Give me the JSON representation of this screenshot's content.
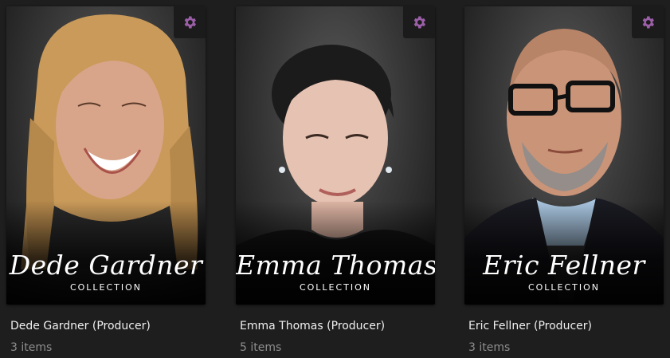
{
  "collections": [
    {
      "poster_script": "Dede Gardner",
      "poster_subtitle": "COLLECTION",
      "title": "Dede Gardner (Producer)",
      "count": "3 items",
      "hair_color": "#c99a5a",
      "skin_color": "#d9a58a"
    },
    {
      "poster_script": "Emma Thomas",
      "poster_subtitle": "COLLECTION",
      "title": "Emma Thomas (Producer)",
      "count": "5 items",
      "hair_color": "#1c1b1b",
      "skin_color": "#e6c2b2"
    },
    {
      "poster_script": "Eric Fellner",
      "poster_subtitle": "COLLECTION",
      "title": "Eric Fellner (Producer)",
      "count": "3 items",
      "hair_color": "#8c8c8c",
      "skin_color": "#c99478"
    }
  ],
  "icons": {
    "settings": "gear-icon"
  },
  "colors": {
    "background": "#1e1e1e",
    "accent": "#9b5fa8",
    "title_text": "#f0f0f0",
    "count_text": "#8e8e8e"
  }
}
